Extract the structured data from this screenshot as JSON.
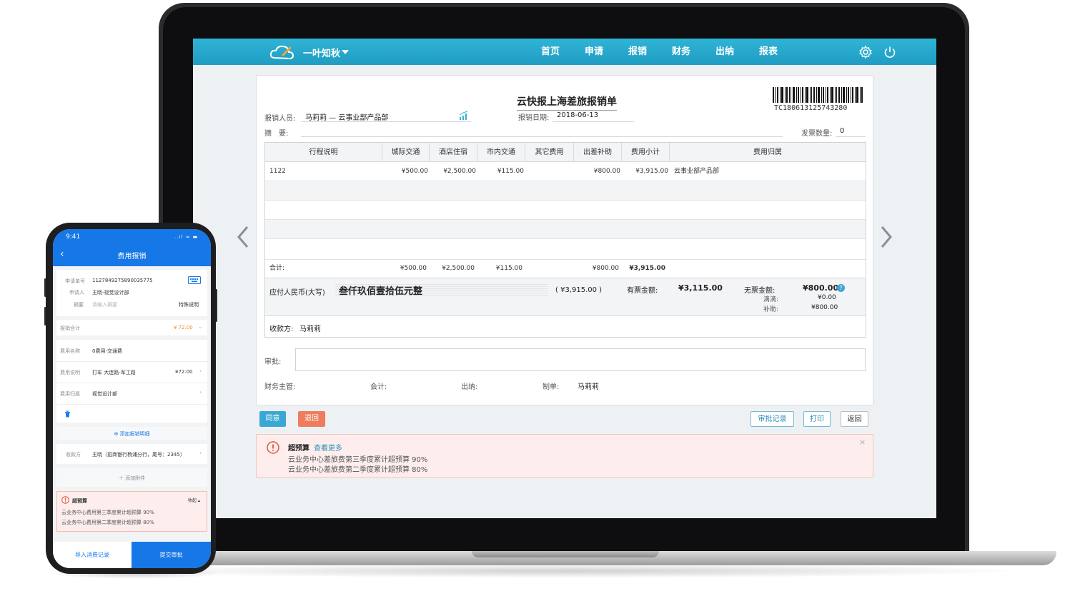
{
  "app": {
    "brand": "一叶知秋",
    "nav": [
      "首页",
      "申请",
      "报销",
      "财务",
      "出纳",
      "报表"
    ]
  },
  "document": {
    "title": "云快报上海差旅报销单",
    "barcode_number": "TC180613125743280",
    "reimburser_label": "报销人员:",
    "reimburser_value": "马莉莉 — 云事业部产品部",
    "date_label": "报销日期:",
    "date_value": "2018-06-13",
    "summary_label": "摘　要:",
    "invoice_count_label": "发票数量:",
    "invoice_count_value": "0",
    "table": {
      "headers": [
        "行程说明",
        "城际交通",
        "酒店住宿",
        "市内交通",
        "其它费用",
        "出差补助",
        "费用小计",
        "费用归属"
      ],
      "rows": [
        [
          "1122",
          "¥500.00",
          "¥2,500.00",
          "¥115.00",
          "",
          "¥800.00",
          "¥3,915.00",
          "云事业部产品部"
        ]
      ],
      "total_label": "合计:",
      "totals": [
        "",
        "¥500.00",
        "¥2,500.00",
        "¥115.00",
        "",
        "¥800.00",
        "¥3,915.00",
        ""
      ]
    },
    "payable_label": "应付人民币(大写)",
    "payable_words": "叁仟玖佰壹拾伍元整",
    "payable_amount": "( ¥3,915.00 )",
    "ticketed_label": "有票金额:",
    "ticketed_value": "¥3,115.00",
    "unticketed_label": "无票金额:",
    "unticketed_value": "¥800.00",
    "drip_label": "滴滴:",
    "drip_value": "¥0.00",
    "subsidy_label": "补助:",
    "subsidy_value": "¥800.00",
    "payee_label": "收款方:",
    "payee_value": "马莉莉",
    "approval_label": "审批:",
    "finance_manager_label": "财务主管:",
    "accountant_label": "会计:",
    "cashier_label": "出纳:",
    "preparer_label": "制单:",
    "preparer_value": "马莉莉"
  },
  "actions": {
    "agree": "同意",
    "reject": "退回",
    "history": "审批记录",
    "print": "打印",
    "back": "返回"
  },
  "alert": {
    "title": "超预算",
    "link": "查看更多",
    "lines": [
      "云业务中心差旅费第三季度累计超预算 90%",
      "云业务中心差旅费第二季度累计超预算 80%"
    ]
  },
  "phone": {
    "time": "9:41",
    "status": "..ıl ≈ ▬",
    "title": "费用报销",
    "app_no_label": "申请单号",
    "app_no_value": "1127849275890035775",
    "applicant_label": "申请人",
    "applicant_value": "王晓-视觉设计部",
    "summary_label": "摘要",
    "summary_placeholder": "请输入摘要",
    "special_note": "特殊说明",
    "total_label": "报销合计",
    "total_value": "¥ 72.00",
    "expense_name_label": "费用名称",
    "expense_name_value": "0费用-交通费",
    "expense_desc_label": "费用说明",
    "expense_desc_value": "打车 大连路-军工路",
    "expense_desc_amount": "¥72.00",
    "expense_owner_label": "费用归属",
    "expense_owner_value": "视觉设计部",
    "add_detail": "⊕ 添加报销明细",
    "payee_label": "收款方",
    "payee_value": "王晓（招商银行杨浦分行，尾号：2345）",
    "add_attachment": "＋ 添加附件",
    "alert_title": "超预算",
    "alert_collapse": "收起 ▴",
    "alert_lines": [
      "云业务中心费用第三季度累计超预算 90%",
      "云业务中心费用第二季度累计超预算 80%"
    ],
    "import_button": "导入消费记录",
    "submit_button": "提交审批"
  },
  "colors": {
    "topbar": "#1f9cc2",
    "accent_blue": "#3aa8d4",
    "reject_orange": "#ef7c5d",
    "phone_blue": "#1677e6",
    "phone_orange": "#f08a24"
  }
}
